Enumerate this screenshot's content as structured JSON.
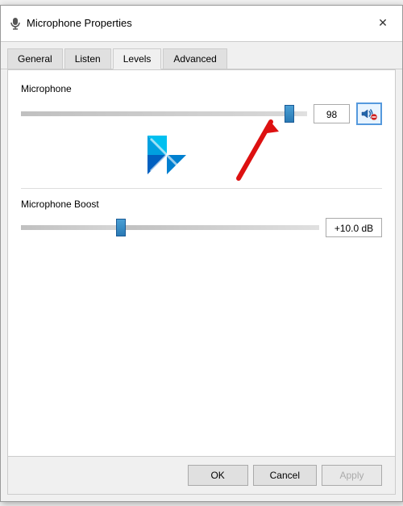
{
  "window": {
    "title": "Microphone Properties",
    "close_label": "✕"
  },
  "tabs": [
    {
      "id": "general",
      "label": "General",
      "active": false
    },
    {
      "id": "listen",
      "label": "Listen",
      "active": false
    },
    {
      "id": "levels",
      "label": "Levels",
      "active": true
    },
    {
      "id": "advanced",
      "label": "Advanced",
      "active": false
    }
  ],
  "levels": {
    "microphone_label": "Microphone",
    "microphone_value": "98",
    "microphone_slider_pct": 96,
    "boost_label": "Microphone Boost",
    "boost_value": "+10.0 dB",
    "boost_slider_pct": 35
  },
  "footer": {
    "ok_label": "OK",
    "cancel_label": "Cancel",
    "apply_label": "Apply"
  }
}
